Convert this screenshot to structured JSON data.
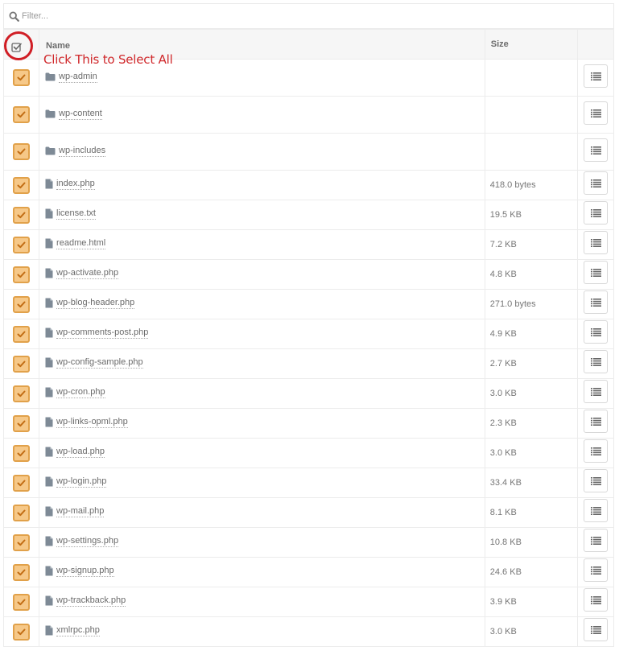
{
  "filter": {
    "placeholder": "Filter..."
  },
  "header": {
    "name_label": "Name",
    "size_label": "Size"
  },
  "annotation": {
    "text": "Click This to Select All"
  },
  "icons": {
    "search": "search-icon",
    "folder": "folder-icon",
    "file": "file-icon",
    "check": "check-icon",
    "list": "list-icon"
  },
  "colors": {
    "checkbox_fill": "#f6c888",
    "checkbox_border": "#e1a14a",
    "check_mark": "#c26d14",
    "annotation_red": "#d0282b"
  },
  "rows": [
    {
      "type": "folder",
      "name": "wp-admin",
      "size": ""
    },
    {
      "type": "folder",
      "name": "wp-content",
      "size": ""
    },
    {
      "type": "folder",
      "name": "wp-includes",
      "size": ""
    },
    {
      "type": "file",
      "name": "index.php",
      "size": "418.0 bytes"
    },
    {
      "type": "file",
      "name": "license.txt",
      "size": "19.5 KB"
    },
    {
      "type": "file",
      "name": "readme.html",
      "size": "7.2 KB"
    },
    {
      "type": "file",
      "name": "wp-activate.php",
      "size": "4.8 KB"
    },
    {
      "type": "file",
      "name": "wp-blog-header.php",
      "size": "271.0 bytes"
    },
    {
      "type": "file",
      "name": "wp-comments-post.php",
      "size": "4.9 KB"
    },
    {
      "type": "file",
      "name": "wp-config-sample.php",
      "size": "2.7 KB"
    },
    {
      "type": "file",
      "name": "wp-cron.php",
      "size": "3.0 KB"
    },
    {
      "type": "file",
      "name": "wp-links-opml.php",
      "size": "2.3 KB"
    },
    {
      "type": "file",
      "name": "wp-load.php",
      "size": "3.0 KB"
    },
    {
      "type": "file",
      "name": "wp-login.php",
      "size": "33.4 KB"
    },
    {
      "type": "file",
      "name": "wp-mail.php",
      "size": "8.1 KB"
    },
    {
      "type": "file",
      "name": "wp-settings.php",
      "size": "10.8 KB"
    },
    {
      "type": "file",
      "name": "wp-signup.php",
      "size": "24.6 KB"
    },
    {
      "type": "file",
      "name": "wp-trackback.php",
      "size": "3.9 KB"
    },
    {
      "type": "file",
      "name": "xmlrpc.php",
      "size": "3.0 KB"
    }
  ]
}
